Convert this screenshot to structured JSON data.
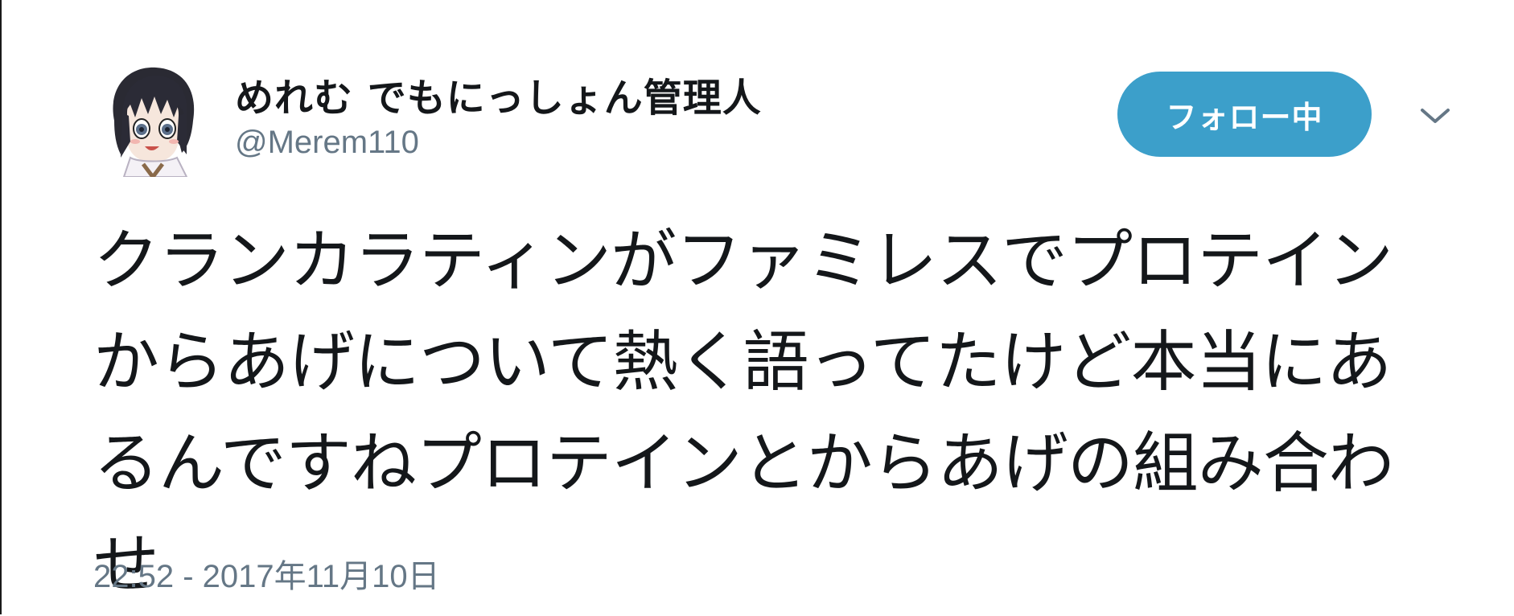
{
  "tweet": {
    "author": {
      "display_name": "めれむ でもにっしょん管理人",
      "handle": "@Merem110",
      "avatar_icon": "anime-character-avatar-icon"
    },
    "follow_button_label": "フォロー中",
    "more_icon": "chevron-down-icon",
    "text": "クランカラティンがファミレスでプロテインからあげについて熱く語ってたけど本当にあるんですねプロテインとからあげの組み合わせ",
    "timestamp": "22:52 - 2017年11月10日"
  },
  "colors": {
    "follow_button_bg": "#3c9fca",
    "secondary_text": "#657786",
    "primary_text": "#14171a"
  }
}
